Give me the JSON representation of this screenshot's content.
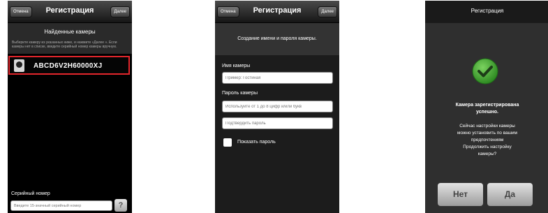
{
  "screen1": {
    "cancel_label": "Отмена",
    "title": "Регистрация",
    "next_label": "Далее",
    "header_title": "Найденные камеры",
    "description": "Выберите камеру из указанных ниже, и нажмите «Далее ». Если камеры нет в списке, введите серийный номер камеры вручную.",
    "camera_id": "ABCD6V2H60000XJ",
    "serial_label": "Серийный номер",
    "serial_placeholder": "Введите 15-значный серийный номер",
    "help_label": "?"
  },
  "screen2": {
    "cancel_label": "Отмена",
    "title": "Регистрация",
    "next_label": "Далее",
    "header_text": "Создание имени и пароля камеры.",
    "name_label": "Имя камеры",
    "name_placeholder": "Пример: Гостиная",
    "password_label": "Пароль камеры",
    "password_placeholder": "Используйте от 1 до 8 цифр и/или букв",
    "confirm_placeholder": "Подтвердить пароль",
    "show_password_label": "Показать пароль"
  },
  "screen3": {
    "title": "Регистрация",
    "success_line1": "Камера зарегистрирована",
    "success_line2": "успешно.",
    "msg_line1": "Сейчас настройки камеры",
    "msg_line2": "можно установить по вашим",
    "msg_line3": "предпочтениям",
    "msg_line4": "Продолжить настройку",
    "msg_line5": "камеры?",
    "no_label": "Нет",
    "yes_label": "Да"
  },
  "colors": {
    "highlight": "#e3262c",
    "success_green": "#3f9b2f"
  }
}
